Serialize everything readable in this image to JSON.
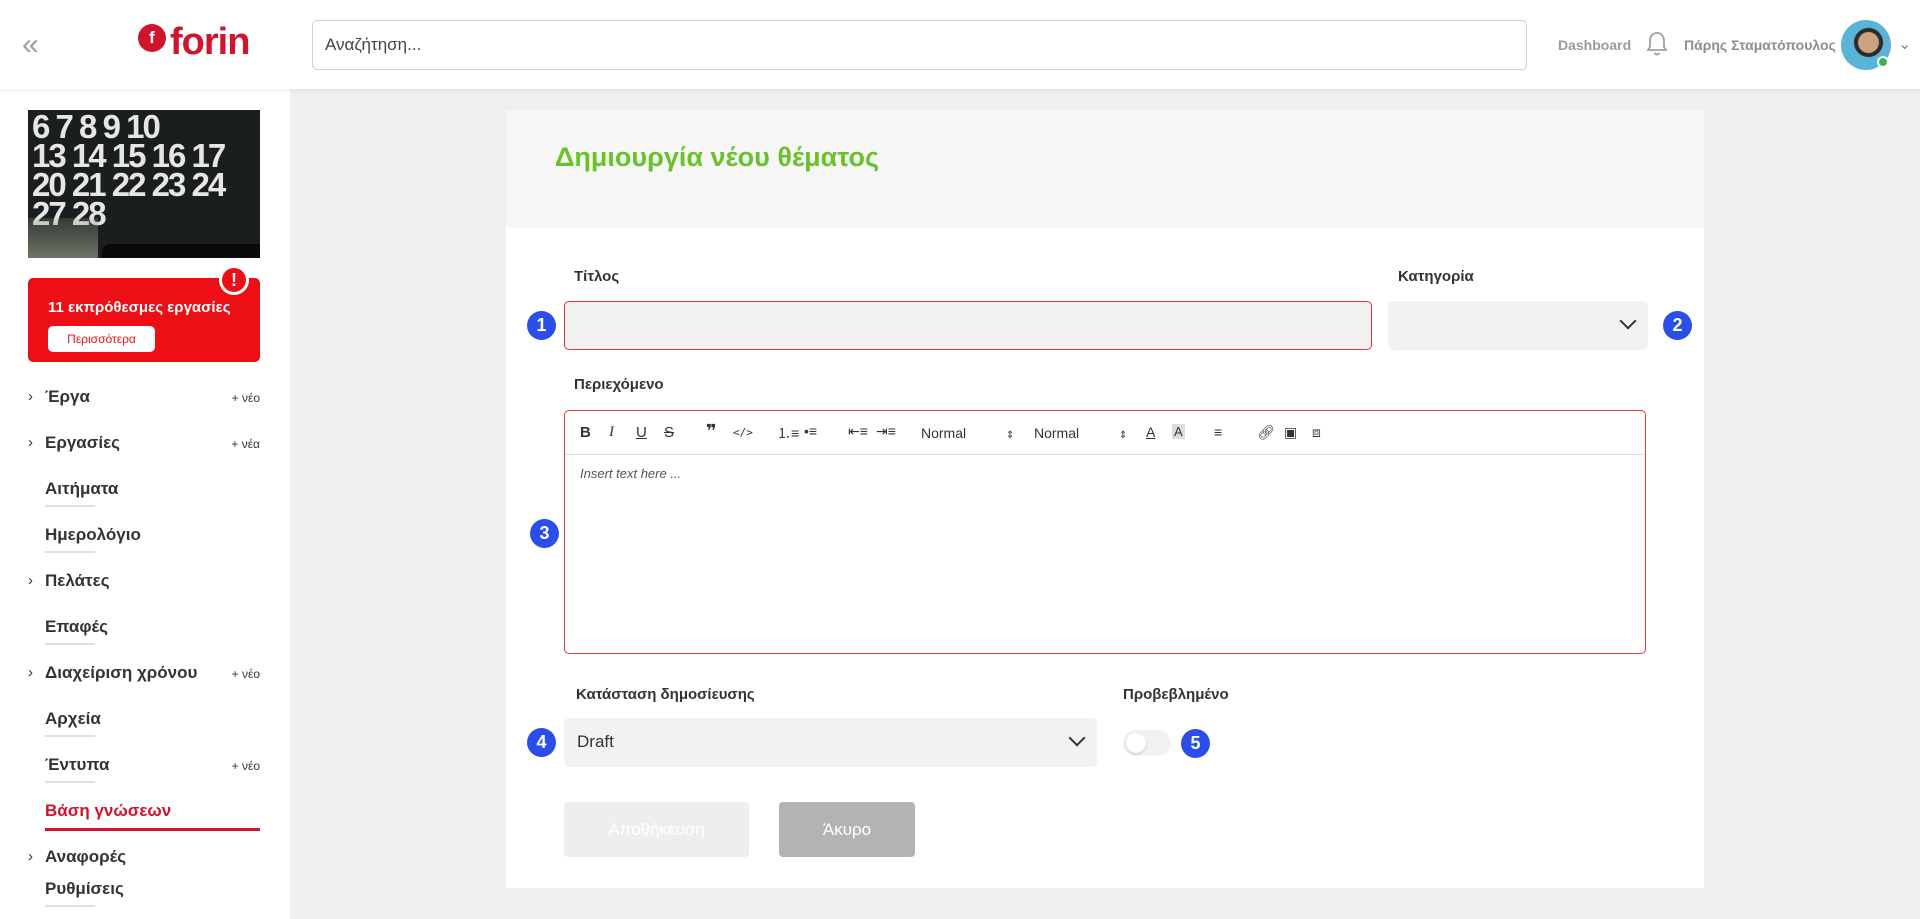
{
  "header": {
    "logo_text": "forin",
    "logo_mark": "f",
    "search_placeholder": "Αναζήτηση...",
    "dashboard_label": "Dashboard",
    "user_name": "Πάρης Σταματόπουλος"
  },
  "sidebar": {
    "calendar_numbers": "6 7 8 9 10\n13 14 15 16 17\n20 21 22 23 24\n27 28",
    "overdue_text": "11 εκπρόθεσμες εργασίες",
    "more_label": "Περισσότερα",
    "alert_symbol": "!",
    "items": [
      {
        "label": "Έργα",
        "new": "+ νέο"
      },
      {
        "label": "Εργασίες",
        "new": "+ νέα"
      },
      {
        "label": "Αιτήματα"
      },
      {
        "label": "Ημερολόγιο"
      },
      {
        "label": "Πελάτες"
      },
      {
        "label": "Επαφές"
      },
      {
        "label": "Διαχείριση χρόνου",
        "new": "+ νέο"
      },
      {
        "label": "Αρχεία"
      },
      {
        "label": "Έντυπα",
        "new": "+ νέο"
      },
      {
        "label": "Βάση γνώσεων"
      },
      {
        "label": "Αναφορές"
      },
      {
        "label": "Ρυθμίσεις"
      }
    ]
  },
  "form": {
    "title": "Δημιουργία νέου θέματος",
    "title_label": "Τίτλος",
    "category_label": "Κατηγορία",
    "content_label": "Περιεχόμενο",
    "editor_placeholder": "Insert text here ...",
    "format_select_1": "Normal",
    "format_select_2": "Normal",
    "status_label": "Κατάσταση δημοσίευσης",
    "status_value": "Draft",
    "featured_label": "Προβεβλημένο",
    "save_label": "Αποθήκευση",
    "cancel_label": "Άκυρο",
    "markers": [
      "1",
      "2",
      "3",
      "4",
      "5"
    ],
    "toggle_on": false
  },
  "colors": {
    "brand": "#d0142c",
    "title_green": "#6bc129",
    "marker_blue": "#2b4de8",
    "alert_red": "#ec0f15"
  }
}
